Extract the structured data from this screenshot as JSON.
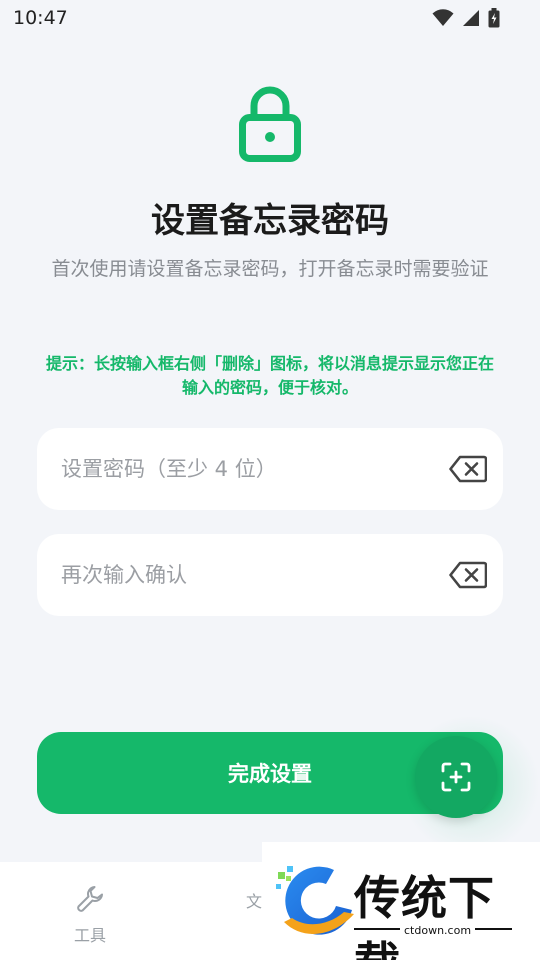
{
  "status_bar": {
    "time": "10:47",
    "icons": [
      "wifi-icon",
      "signal-icon",
      "battery-charging-icon"
    ]
  },
  "header": {
    "icon": "lock-icon",
    "title": "设置备忘录密码",
    "subtitle": "首次使用请设置备忘录密码，打开备忘录时需要验证"
  },
  "hint": "提示：长按输入框右侧「删除」图标，将以消息提示显示您正在输入的密码，便于核对。",
  "fields": {
    "password": {
      "placeholder": "设置密码（至少 4 位）",
      "value": ""
    },
    "confirm": {
      "placeholder": "再次输入确认",
      "value": ""
    }
  },
  "submit_label": "完成设置",
  "fab_icon": "scan-add-icon",
  "bottom_nav": {
    "items": [
      {
        "label": "工具",
        "icon": "wrench-icon"
      },
      {
        "label": "文",
        "icon": "document-icon"
      }
    ]
  },
  "watermark": {
    "brand": "传统下载",
    "url": "ctdown.com"
  },
  "colors": {
    "accent": "#15b86a",
    "background": "#f3f5f9",
    "hint": "#15b86a"
  }
}
